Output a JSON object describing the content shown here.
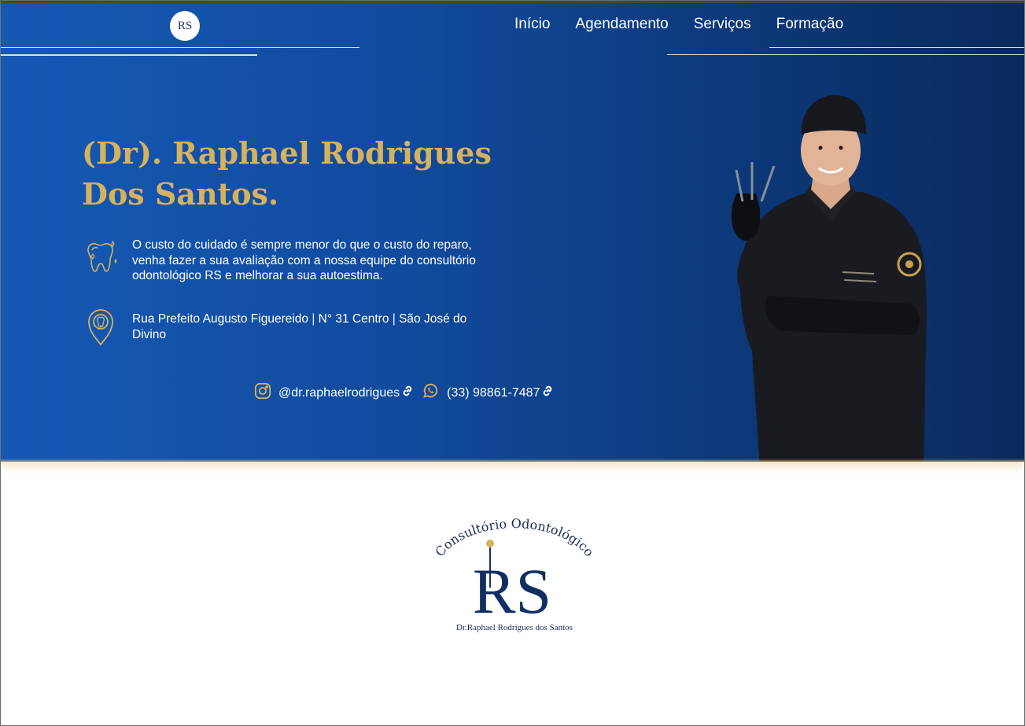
{
  "nav": {
    "logo_text": "RS",
    "items": [
      {
        "label": "Início"
      },
      {
        "label": "Agendamento"
      },
      {
        "label": "Serviços"
      },
      {
        "label": "Formação"
      }
    ]
  },
  "hero": {
    "title": "(Dr). Raphael Rodrigues Dos Santos.",
    "description": "O custo do cuidado é sempre menor do que o custo do reparo, venha fazer a sua avaliação com a nossa equipe do consultório odontológico RS e melhorar a sua autoestima.",
    "address": "Rua Prefeito Augusto Figuereido | N° 31 Centro | São José do Divino",
    "instagram": "@dr.raphaelrodrigues",
    "whatsapp": "(33) 98861-7487"
  },
  "footer_logo": {
    "arc_text": "Consultório Odontológico",
    "monogram": "RS",
    "name": "Dr.Raphael Rodrigues dos Santos"
  },
  "colors": {
    "gold": "#d6b25e",
    "navy": "#0f2f63",
    "blue": "#1559b5"
  },
  "icons": [
    "tooth-icon",
    "location-pin-icon",
    "instagram-icon",
    "whatsapp-icon",
    "link-icon"
  ]
}
